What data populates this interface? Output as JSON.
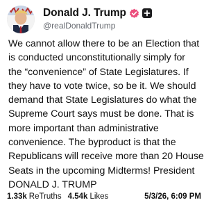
{
  "author": {
    "display_name": "Donald J. Trump",
    "handle": "@realDonaldTrump",
    "avatar_icon": "profile-photo",
    "verified_icon": "verified-badge-icon",
    "verified_color": "#ec4e7c",
    "action_icon": "add-follow-icon"
  },
  "post": {
    "lines": [
      "We cannot allow there to be an Election that",
      "is conducted unconstitutionally simply for",
      "the “convenience” of State Legislatures. If",
      "they have to vote twice, so be it. We should",
      "demand that State Legislatures do what the",
      "Supreme Court says must be done. That is",
      "more important than administrative",
      "convenience. The byproduct is that the",
      "Republicans will receive more than 20 House",
      "Seats in the upcoming Midterms! President",
      "DONALD J. TRUMP"
    ]
  },
  "stats": {
    "retruths_count": "1.33k",
    "retruths_label": "ReTruths",
    "likes_count": "4.54k",
    "likes_label": "Likes"
  },
  "timestamp": "5/3/26, 6:09 PM"
}
